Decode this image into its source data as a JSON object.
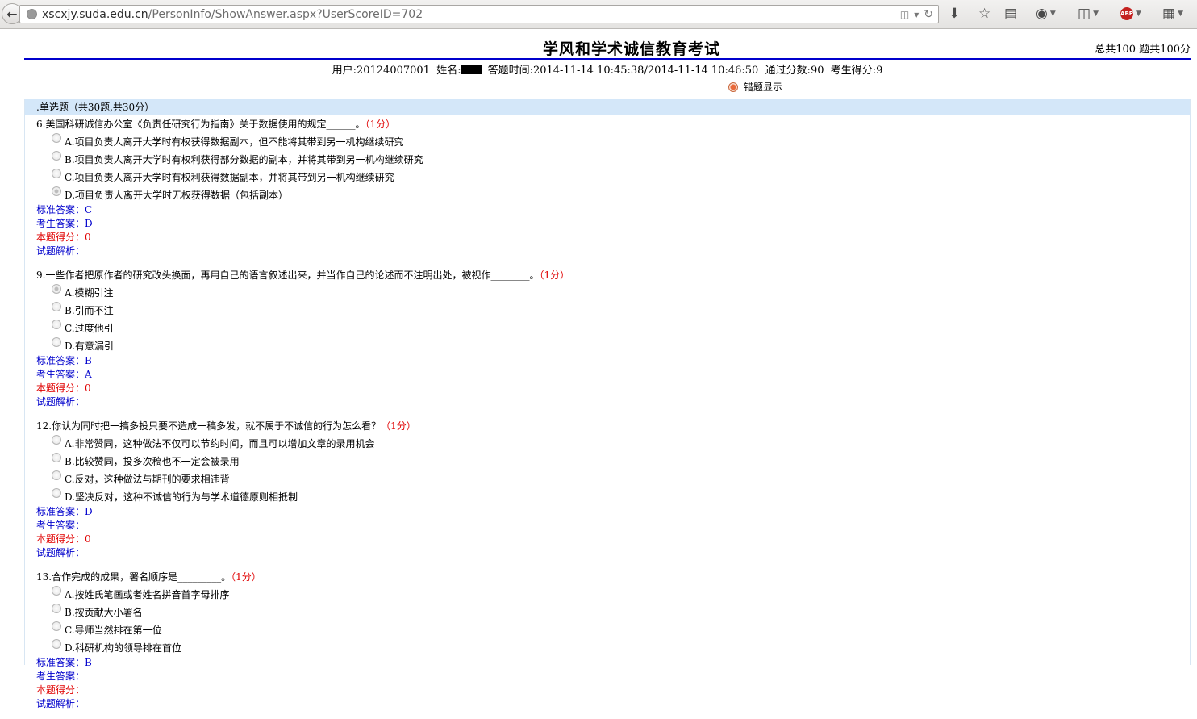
{
  "browser": {
    "url_host": "xscxjy.suda.edu.cn",
    "url_path": "/PersonInfo/ShowAnswer.aspx?UserScoreID=702"
  },
  "page": {
    "title": "学风和学术诚信教育考试",
    "score_summary": "总共100 题共100分",
    "user_info_before_name": "用户:20124007001  姓名:",
    "user_info_after_name": "答题时间:2014-11-14 10:45:38/2014-11-14 10:46:50  通过分数:90  考生得分:9",
    "wrong_only_label": "错题显示"
  },
  "section": {
    "header": "一.单选题（共30题,共30分）"
  },
  "labels": {
    "standard_answer": "标准答案：",
    "your_answer": "考生答案：",
    "score": "本题得分：",
    "analysis": "试题解析："
  },
  "questions": [
    {
      "stem": "6.美国科研诚信办公室《负责任研究行为指南》关于数据使用的规定______。",
      "points": "（1分）",
      "options": [
        "A.项目负责人离开大学时有权获得数据副本，但不能将其带到另一机构继续研究",
        "B.项目负责人离开大学时有权利获得部分数据的副本，并将其带到另一机构继续研究",
        "C.项目负责人离开大学时有权利获得数据副本，并将其带到另一机构继续研究",
        "D.项目负责人离开大学时无权获得数据（包括副本）"
      ],
      "selected": 3,
      "standard_answer": "C",
      "your_answer": "D",
      "score": "0",
      "analysis": ""
    },
    {
      "stem": "9.一些作者把原作者的研究改头换面，再用自己的语言叙述出来，并当作自己的论述而不注明出处，被视作________。",
      "points": "（1分）",
      "options": [
        "A.模糊引注",
        "B.引而不注",
        "C.过度他引",
        "D.有意漏引"
      ],
      "selected": 0,
      "standard_answer": "B",
      "your_answer": "A",
      "score": "0",
      "analysis": ""
    },
    {
      "stem": "12.你认为同时把一搞多投只要不造成一稿多发，就不属于不诚信的行为怎么看？",
      "points": "（1分）",
      "options": [
        "A.非常赞同，这种做法不仅可以节约时间，而且可以增加文章的录用机会",
        "B.比较赞同，投多次稿也不一定会被录用",
        "C.反对，这种做法与期刊的要求相违背",
        "D.坚决反对，这种不诚信的行为与学术道德原则相抵制"
      ],
      "selected": -1,
      "standard_answer": "D",
      "your_answer": "",
      "score": "0",
      "analysis": ""
    },
    {
      "stem": "13.合作完成的成果，署名顺序是_________。",
      "points": "（1分）",
      "options": [
        "A.按姓氏笔画或者姓名拼音首字母排序",
        "B.按贡献大小署名",
        "C.导师当然排在第一位",
        "D.科研机构的领导排在首位"
      ],
      "selected": -1,
      "standard_answer": "B",
      "your_answer": "",
      "score": "",
      "analysis": ""
    }
  ]
}
